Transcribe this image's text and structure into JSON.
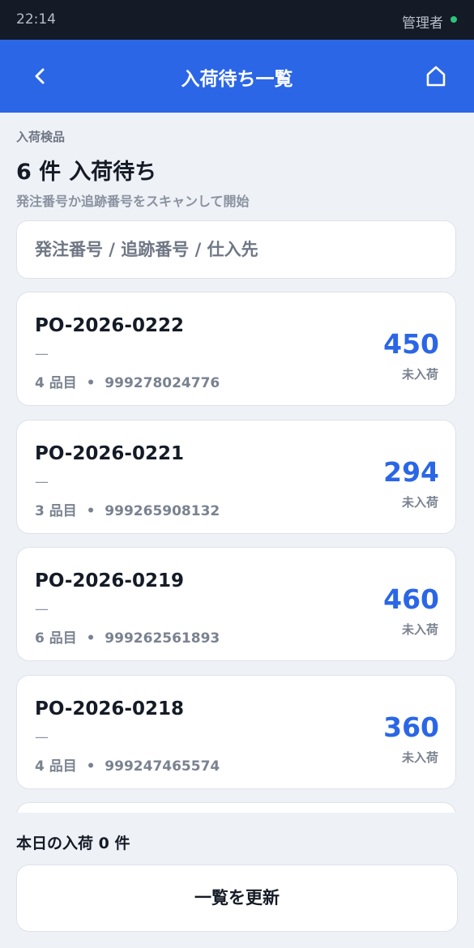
{
  "status_bar": {
    "time": "22:14",
    "user": "管理者"
  },
  "app_bar": {
    "title": "入荷待ち一覧",
    "back_icon": "chevron-left-icon",
    "home_icon": "home-icon"
  },
  "header": {
    "section_label": "入荷検品",
    "count": "6 件",
    "heading": "入荷待ち",
    "hint": "発注番号か追跡番号をスキャンして開始"
  },
  "search": {
    "placeholder": "発注番号 / 追跡番号 / 仕入先",
    "value": ""
  },
  "orders": [
    {
      "po": "PO-2026-0222",
      "supplier": "—",
      "items": "4 品目",
      "tracking": "999278024776",
      "qty": "450",
      "qty_label": "未入荷"
    },
    {
      "po": "PO-2026-0221",
      "supplier": "—",
      "items": "3 品目",
      "tracking": "999265908132",
      "qty": "294",
      "qty_label": "未入荷"
    },
    {
      "po": "PO-2026-0219",
      "supplier": "—",
      "items": "6 品目",
      "tracking": "999262561893",
      "qty": "460",
      "qty_label": "未入荷"
    },
    {
      "po": "PO-2026-0218",
      "supplier": "—",
      "items": "4 品目",
      "tracking": "999247465574",
      "qty": "360",
      "qty_label": "未入荷"
    }
  ],
  "footer": {
    "today": "本日の入荷 0 件",
    "refresh_label": "一覧を更新"
  },
  "colors": {
    "accent": "#2b66e6",
    "status_bar": "#141a26",
    "online": "#2ec47a"
  }
}
